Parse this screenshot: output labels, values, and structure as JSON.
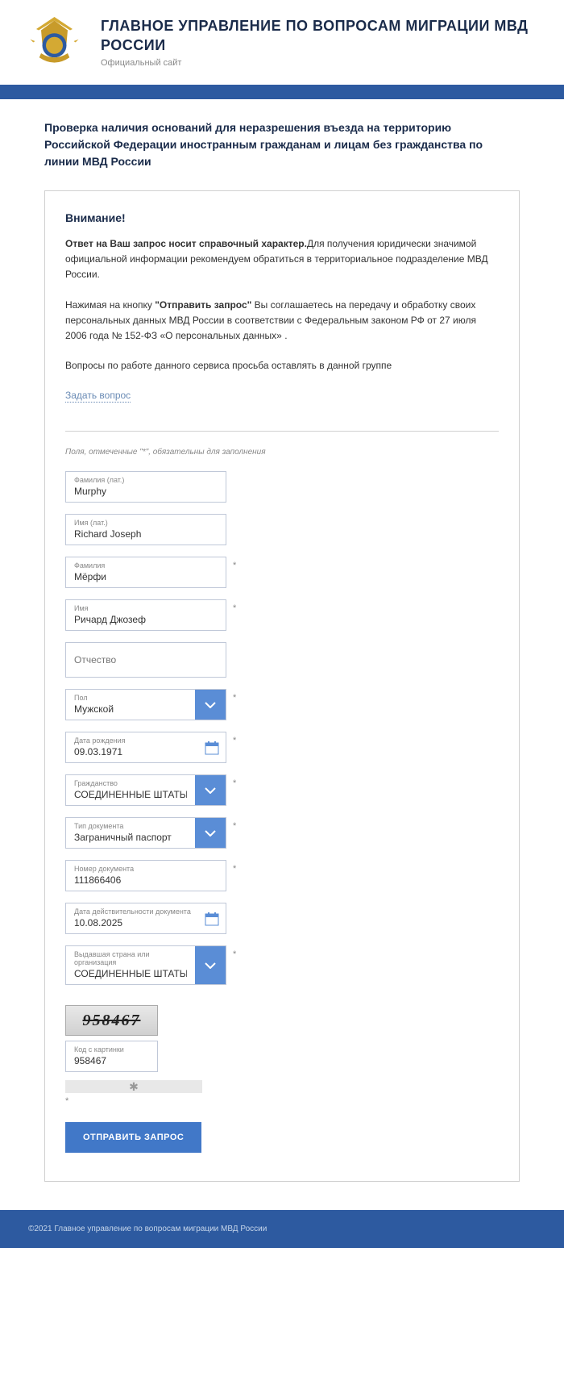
{
  "header": {
    "title": "ГЛАВНОЕ УПРАВЛЕНИЕ ПО ВОПРОСАМ МИГРАЦИИ МВД РОССИИ",
    "subtitle": "Официальный сайт"
  },
  "page_title": "Проверка наличия оснований для неразрешения въезда на территорию Российской Федерации иностранным гражданам и лицам без гражданства по линии МВД России",
  "notice": {
    "heading": "Внимание!",
    "p1_bold": "Ответ на Ваш запрос носит справочный характер.",
    "p1_rest": "Для получения юридически значимой официальной информации рекомендуем обратиться в территориальное подразделение МВД России.",
    "p2_pre": "Нажимая на кнопку ",
    "p2_bold": "\"Отправить запрос\"",
    "p2_rest": " Вы соглашаетесь на передачу и обработку своих персональных данных МВД России в соответствии с Федеральным законом РФ от 27 июля 2006 года № 152-ФЗ «О персональных данных» .",
    "p3": "Вопросы по работе данного сервиса просьба оставлять в данной группе",
    "ask_link": "Задать вопрос"
  },
  "form": {
    "hint": "Поля, отмеченные \"*\", обязательны для заполнения",
    "fields": {
      "surname_lat": {
        "label": "Фамилия (лат.)",
        "value": "Murphy"
      },
      "name_lat": {
        "label": "Имя (лат.)",
        "value": "Richard Joseph"
      },
      "surname": {
        "label": "Фамилия",
        "value": "Мёрфи"
      },
      "name": {
        "label": "Имя",
        "value": "Ричард Джозеф"
      },
      "patronymic": {
        "label": "Отчество",
        "value": ""
      },
      "gender": {
        "label": "Пол",
        "value": "Мужской"
      },
      "birthdate": {
        "label": "Дата рождения",
        "value": "09.03.1971"
      },
      "citizenship": {
        "label": "Гражданство",
        "value": "СОЕДИНЕННЫЕ ШТАТЫ"
      },
      "doc_type": {
        "label": "Тип документа",
        "value": "Заграничный паспорт"
      },
      "doc_number": {
        "label": "Номер документа",
        "value": "111866406"
      },
      "doc_valid": {
        "label": "Дата действительности документа",
        "value": "10.08.2025"
      },
      "issuer": {
        "label": "Выдавшая страна или организация",
        "value": "СОЕДИНЕННЫЕ ШТАТЫ"
      },
      "captcha": {
        "label": "Код с картинки",
        "value": "958467",
        "image_text": "958467"
      }
    },
    "submit": "ОТПРАВИТЬ ЗАПРОС"
  },
  "footer": "©2021 Главное управление по вопросам миграции МВД России"
}
